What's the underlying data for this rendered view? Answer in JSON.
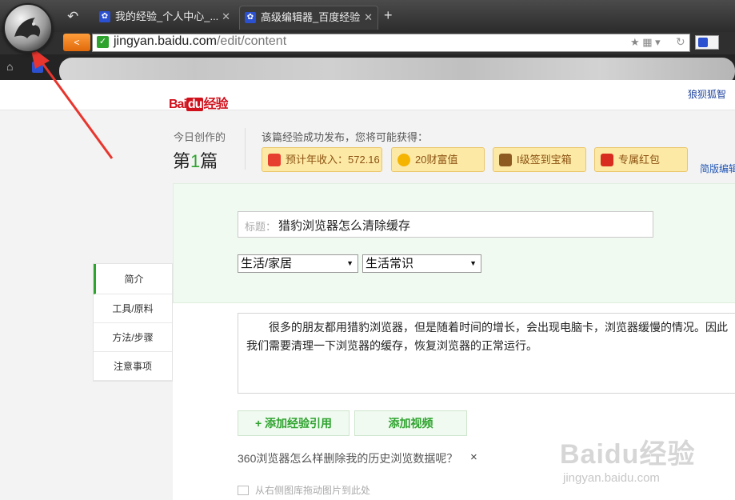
{
  "browser": {
    "tabs": [
      {
        "title": "我的经验_个人中心_...",
        "active": false
      },
      {
        "title": "高级编辑器_百度经验",
        "active": true
      }
    ],
    "url_host": "jingyan.baidu.com",
    "url_path": "/edit/content"
  },
  "header": {
    "logo_prefix": "Bai",
    "logo_badge": "du",
    "logo_suffix": "经验",
    "user_name": "狼狈狐智"
  },
  "stats": {
    "today_label": "今日创作的",
    "count_prefix": "第",
    "count": "1",
    "count_suffix": "篇",
    "reward_heading": "该篇经验成功发布，您将可能获得：",
    "rewards": [
      {
        "label": "预计年收入：572.16",
        "icon": "money-icon"
      },
      {
        "label": "20财富值",
        "icon": "coin-icon"
      },
      {
        "label": "I级签到宝箱",
        "icon": "chest-icon"
      },
      {
        "label": "专属红包",
        "icon": "red-packet-icon"
      }
    ],
    "simple_edit": "简版编辑"
  },
  "form": {
    "title_label": "标题：",
    "title_value": "猎豹浏览器怎么清除缓存",
    "category1": "生活/家居",
    "category2": "生活常识"
  },
  "side_nav": [
    "简介",
    "工具/原料",
    "方法/步骤",
    "注意事项"
  ],
  "intro": {
    "text": "很多的朋友都用猎豹浏览器，但是随着时间的增长，会出现电脑卡，浏览器缓慢的情况。因此我们需要清理一下浏览器的缓存，恢复浏览器的正常运行。"
  },
  "buttons": {
    "add_reference": "+ 添加经验引用",
    "add_video": "添加视频"
  },
  "related_question": "360浏览器怎么样删除我的历史浏览数据呢？",
  "close_symbol": "×",
  "drag_hint": "从右侧图库拖动图片到此处",
  "watermark": {
    "main": "Baidu经验",
    "sub": "jingyan.baidu.com"
  },
  "colors": {
    "accent_green": "#2ea32e",
    "back_orange": "#ff8a1f",
    "annotation_red": "#e8352e"
  }
}
